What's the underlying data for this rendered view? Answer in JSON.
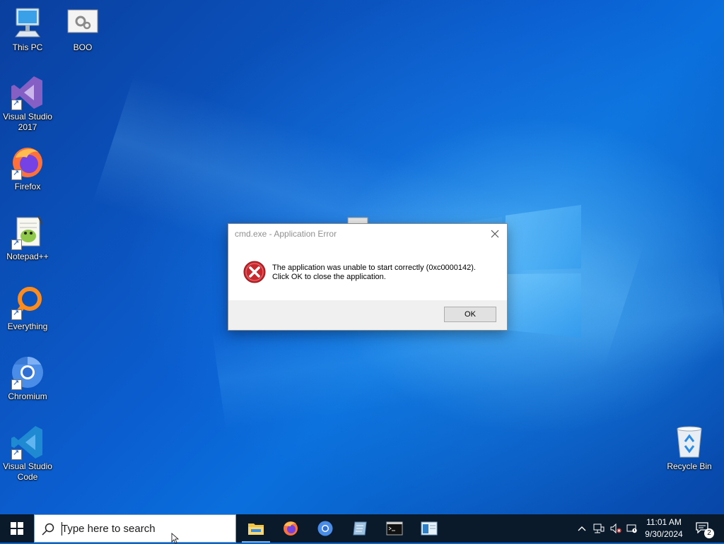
{
  "desktop": {
    "icons": [
      {
        "label": "This PC"
      },
      {
        "label": "BOO"
      },
      {
        "label": "Visual Studio 2017"
      },
      {
        "label": "Firefox"
      },
      {
        "label": "Notepad++"
      },
      {
        "label": "Everything"
      },
      {
        "label": "Chromium"
      },
      {
        "label": "Visual Studio Code"
      },
      {
        "label": "Recycle Bin"
      }
    ]
  },
  "dialog": {
    "title": "cmd.exe - Application Error",
    "message_line1": "The application was unable to start correctly (0xc0000142).",
    "message_line2": "Click OK to close the application.",
    "ok_label": "OK",
    "icon": "error-icon"
  },
  "taskbar": {
    "search_placeholder": "Type here to search",
    "apps": [
      "file-explorer",
      "firefox",
      "chromium",
      "visual-studio-code",
      "command-prompt",
      "app-window"
    ],
    "clock_time": "11:01 AM",
    "clock_date": "9/30/2024",
    "notification_count": "2"
  },
  "colors": {
    "taskbar_bg": "#0a1a2b",
    "desktop_accent": "#0a6fdc",
    "error_red": "#c8282d"
  }
}
